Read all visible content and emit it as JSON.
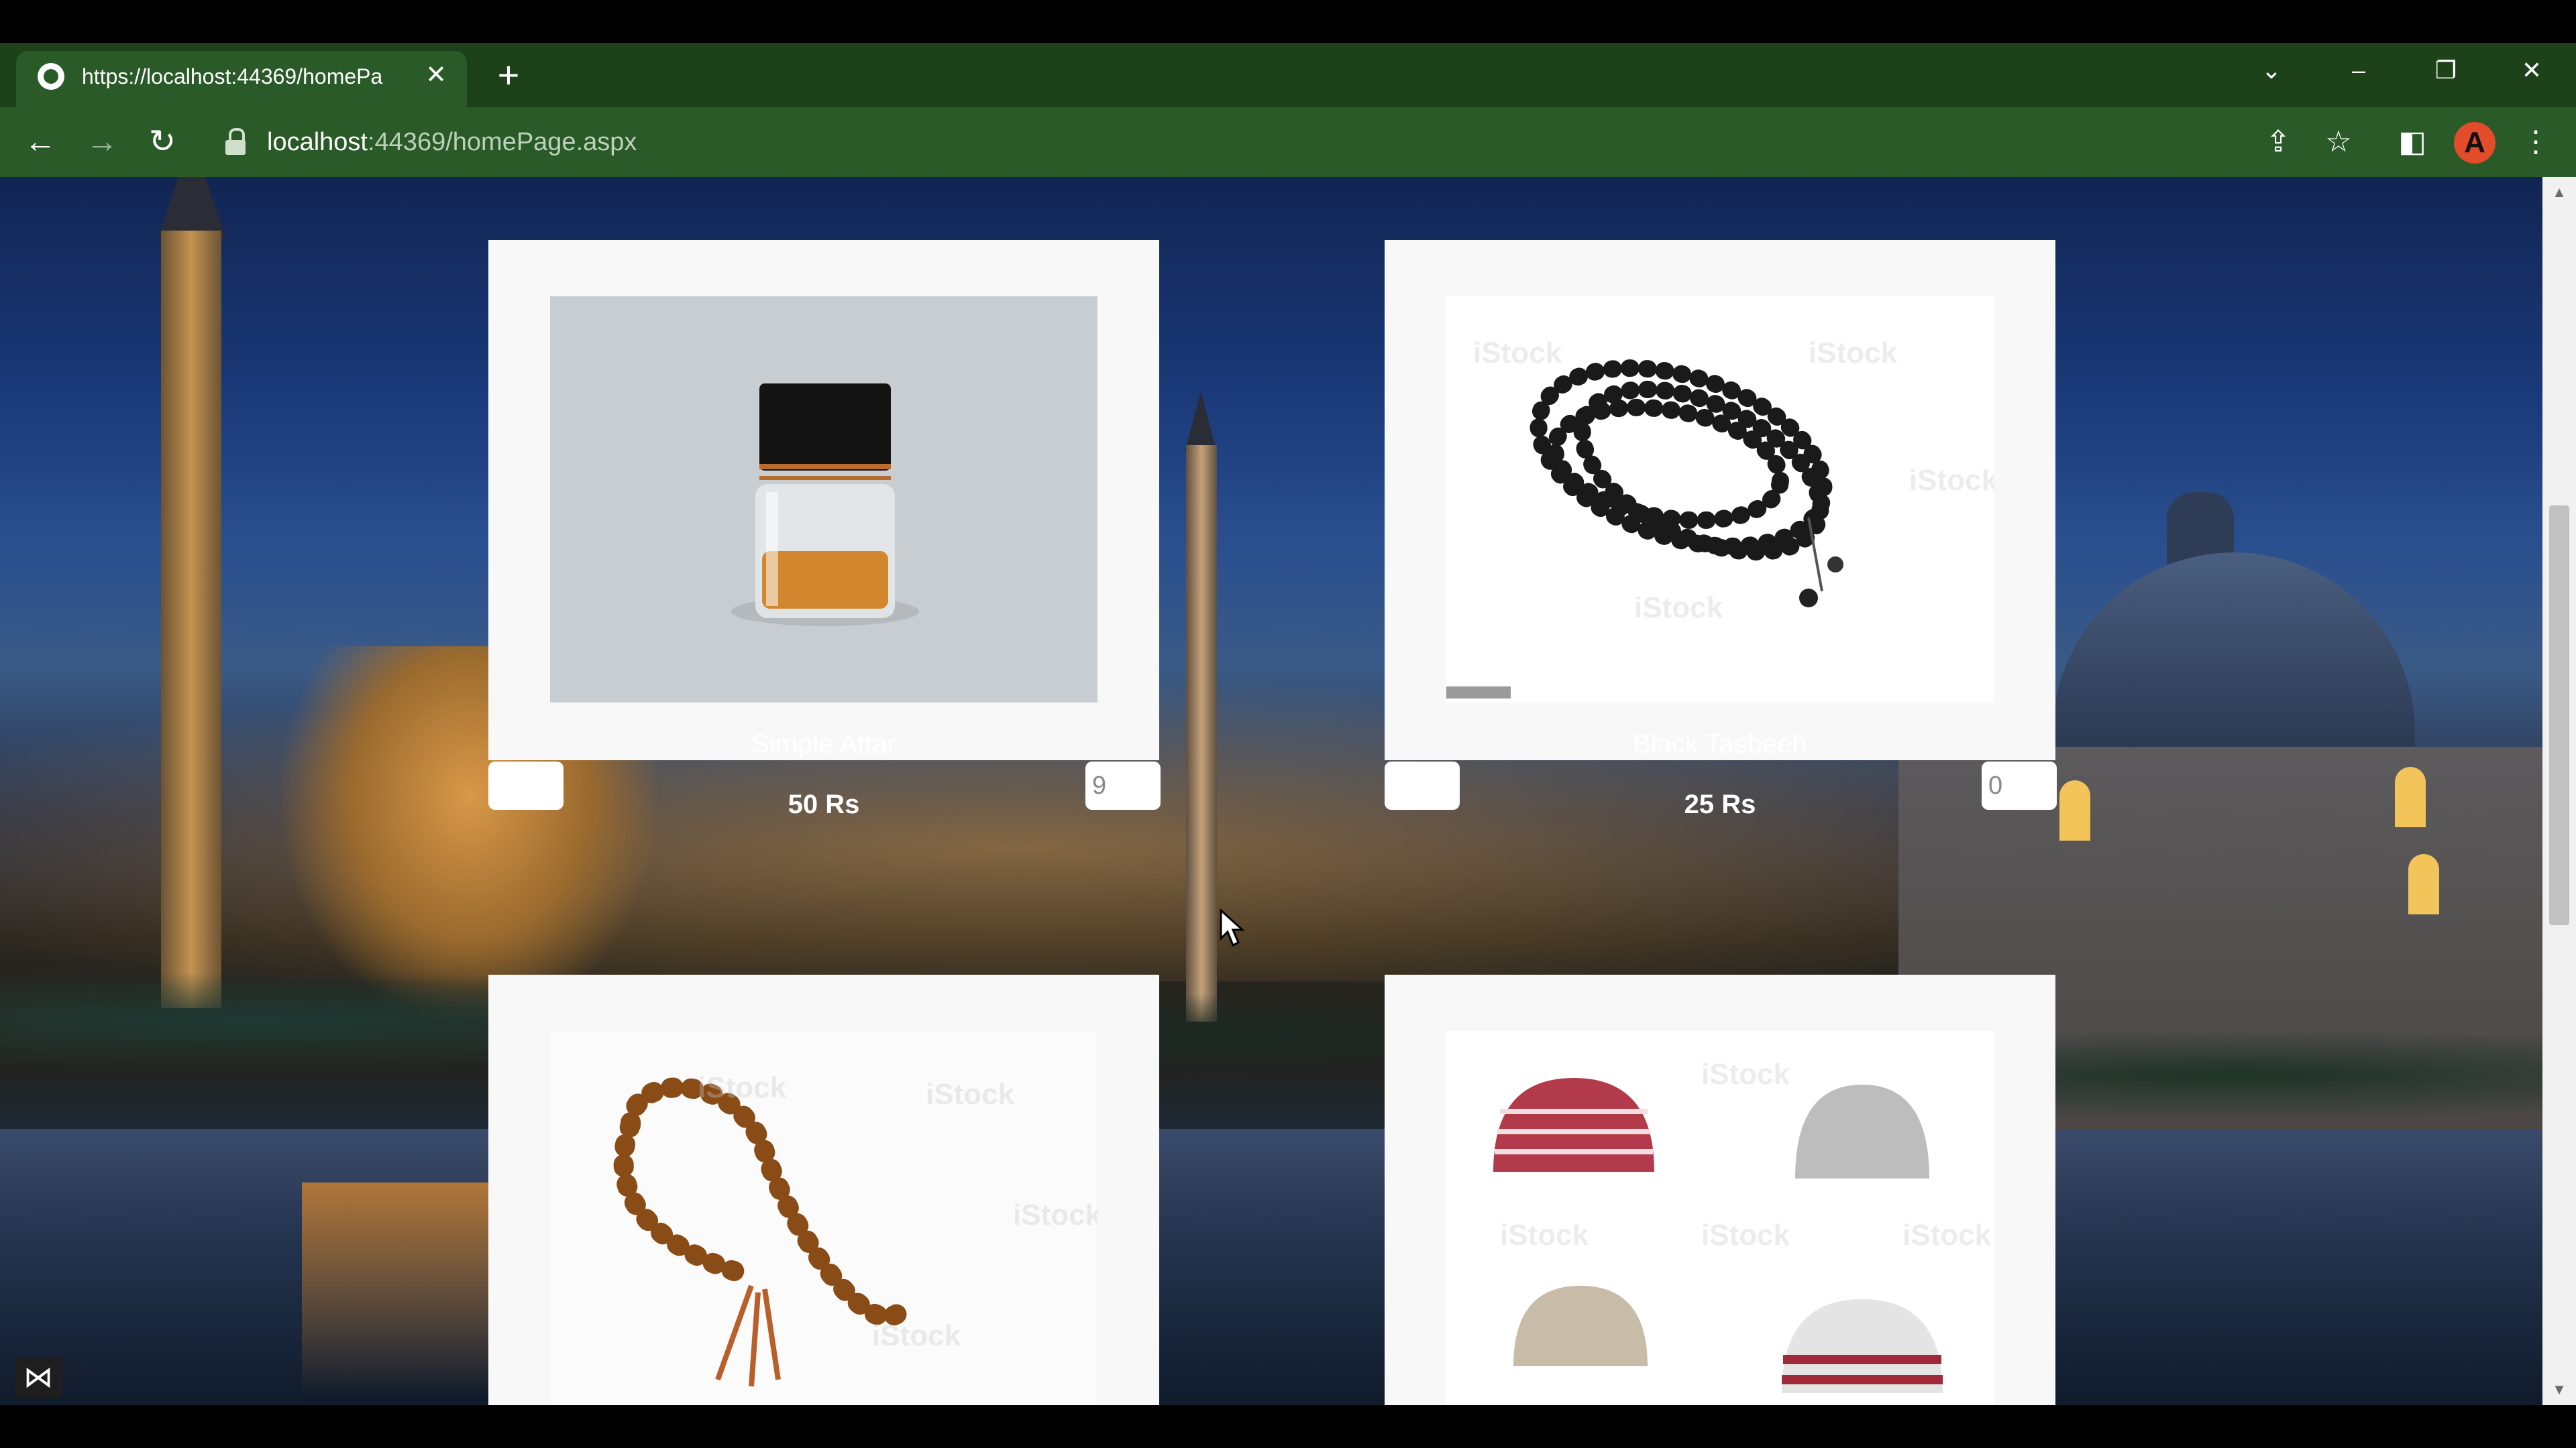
{
  "browser": {
    "tab_title": "https://localhost:44369/homePa",
    "close_glyph": "✕",
    "newtab_glyph": "+",
    "url_host": "localhost",
    "url_rest": ":44369/homePage.aspx",
    "avatar_letter": "A",
    "icons": [
      "globe-icon",
      "back-icon",
      "forward-icon",
      "reload-icon",
      "lock-icon",
      "share-icon",
      "star-icon",
      "sidebar-icon",
      "menu-icon",
      "tab-search-icon",
      "minimize-icon",
      "restore-icon",
      "close-icon"
    ]
  },
  "products": [
    {
      "name": "Simple Attar",
      "price": "50 Rs",
      "quantity": "9"
    },
    {
      "name": "Black Tasbeeh",
      "price": "25 Rs",
      "quantity": "0"
    },
    {
      "name": "",
      "price": "",
      "quantity": ""
    },
    {
      "name": "",
      "price": "",
      "quantity": ""
    }
  ],
  "watermark_text": "iStock",
  "colors": {
    "toolbar": "#2a5a27",
    "tabstrip": "#1d421a",
    "card": "#f8f8f8"
  }
}
